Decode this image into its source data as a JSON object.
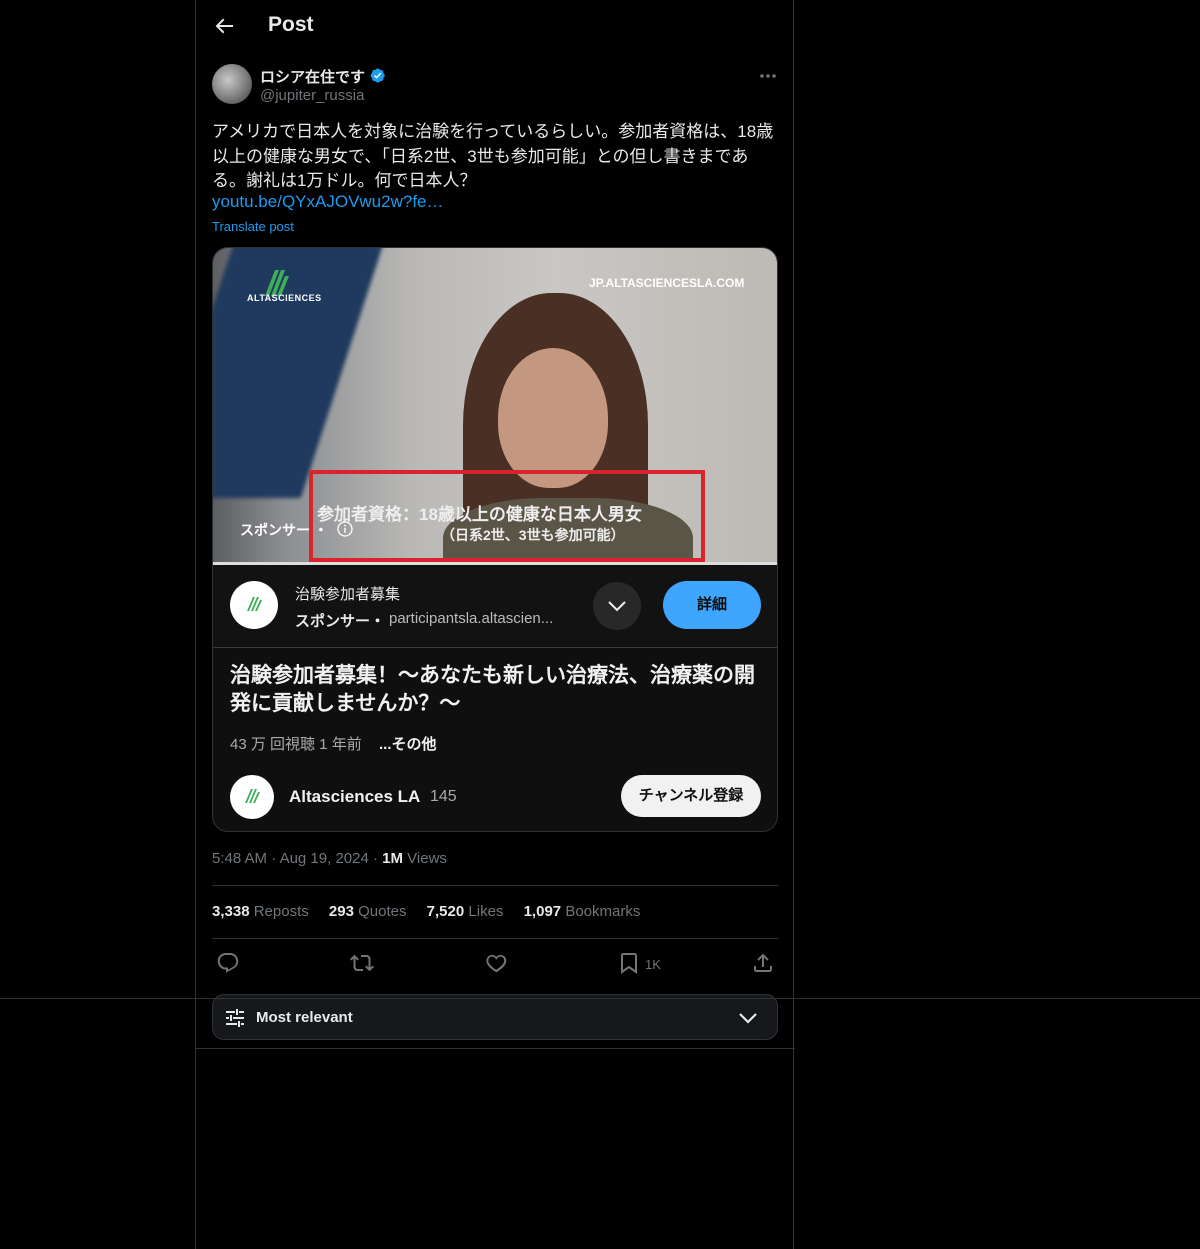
{
  "header": {
    "title": "Post"
  },
  "author": {
    "name": "ロシア在住です",
    "handle": "@jupiter_russia",
    "verified": true
  },
  "tweet": {
    "text": "アメリカで日本人を対象に治験を行っているらしい。参加者資格は、18歳以上の健康な男女で、「日系2世、3世も参加可能」との但し書きまである。謝礼は1万ドル。何で日本人？",
    "link": "youtu.be/QYxAJOVwu2w?fe…",
    "translate_label": "Translate post"
  },
  "video": {
    "logo_text": "ALTASCIENCES",
    "site_text": "JP.ALTASCIENCESLA.COM",
    "subtitle_main": "参加者資格：18歳以上の健康な日本人男女",
    "subtitle_sub": "（日系2世、3世も参加可能）",
    "sponsor_overlay": "スポンサー ・",
    "progress": 1.0
  },
  "ad": {
    "title": "治験参加者募集",
    "sponsor_label": "スポンサー・",
    "url": "participantsla.altascien...",
    "detail_button": "詳細"
  },
  "youtube": {
    "title": "治験参加者募集！〜あなたも新しい治療法、治療薬の開発に貢献しませんか？〜",
    "meta": "43 万 回視聴 1 年前",
    "more": "...その他",
    "channel_name": "Altasciences LA",
    "subscriber_count": "145",
    "subscribe_button": "チャンネル登録"
  },
  "meta": {
    "time": "5:48 AM",
    "date": "Aug 19, 2024",
    "views_count": "1M",
    "views_label": "Views"
  },
  "stats": {
    "reposts_count": "3,338",
    "reposts_label": "Reposts",
    "quotes_count": "293",
    "quotes_label": "Quotes",
    "likes_count": "7,520",
    "likes_label": "Likes",
    "bookmarks_count": "1,097",
    "bookmarks_label": "Bookmarks"
  },
  "actions": {
    "bookmark_count": "1K"
  },
  "filter": {
    "label": "Most relevant"
  },
  "colors": {
    "accent": "#1d9bf0",
    "youtube_button": "#3ea6ff",
    "highlight_box": "#d9232d"
  }
}
